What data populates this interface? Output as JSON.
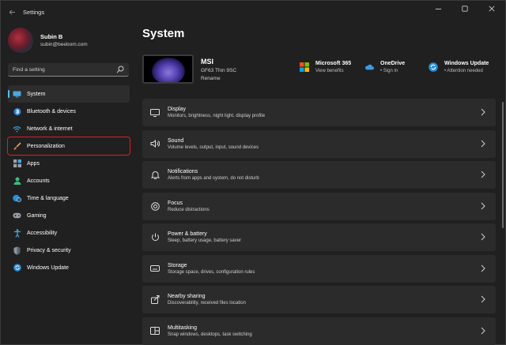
{
  "window": {
    "app_title": "Settings"
  },
  "profile": {
    "name": "Subin B",
    "email": "subin@beebom.com"
  },
  "search": {
    "placeholder": "Find a setting"
  },
  "nav": [
    {
      "label": "System",
      "icon": "monitor-icon"
    },
    {
      "label": "Bluetooth & devices",
      "icon": "bluetooth-icon"
    },
    {
      "label": "Network & internet",
      "icon": "wifi-icon"
    },
    {
      "label": "Personalization",
      "icon": "brush-icon"
    },
    {
      "label": "Apps",
      "icon": "apps-icon"
    },
    {
      "label": "Accounts",
      "icon": "person-icon"
    },
    {
      "label": "Time & language",
      "icon": "globe-clock-icon"
    },
    {
      "label": "Gaming",
      "icon": "gamepad-icon"
    },
    {
      "label": "Accessibility",
      "icon": "accessibility-icon"
    },
    {
      "label": "Privacy & security",
      "icon": "shield-icon"
    },
    {
      "label": "Windows Update",
      "icon": "update-icon"
    }
  ],
  "main": {
    "title": "System",
    "device": {
      "name": "MSI",
      "model": "GF63 Thin 9SC",
      "rename": "Rename"
    },
    "quick": [
      {
        "title": "Microsoft 365",
        "sub": "View benefits",
        "icon": "microsoft-icon"
      },
      {
        "title": "OneDrive",
        "sub": "• Sign in",
        "icon": "cloud-icon"
      },
      {
        "title": "Windows Update",
        "sub": "• Attention needed",
        "icon": "update-icon"
      }
    ],
    "cards": [
      {
        "title": "Display",
        "sub": "Monitors, brightness, night light, display profile",
        "icon": "display-icon"
      },
      {
        "title": "Sound",
        "sub": "Volume levels, output, input, sound devices",
        "icon": "speaker-icon"
      },
      {
        "title": "Notifications",
        "sub": "Alerts from apps and system, do not disturb",
        "icon": "bell-icon"
      },
      {
        "title": "Focus",
        "sub": "Reduce distractions",
        "icon": "focus-icon"
      },
      {
        "title": "Power & battery",
        "sub": "Sleep, battery usage, battery saver",
        "icon": "power-icon"
      },
      {
        "title": "Storage",
        "sub": "Storage space, drives, configuration rules",
        "icon": "storage-icon"
      },
      {
        "title": "Nearby sharing",
        "sub": "Discoverability, received files location",
        "icon": "share-icon"
      },
      {
        "title": "Multitasking",
        "sub": "Snap windows, desktops, task switching",
        "icon": "multitask-icon"
      }
    ]
  },
  "colors": {
    "accent": "#4cc2ff",
    "highlight_box": "#d81e2a"
  }
}
